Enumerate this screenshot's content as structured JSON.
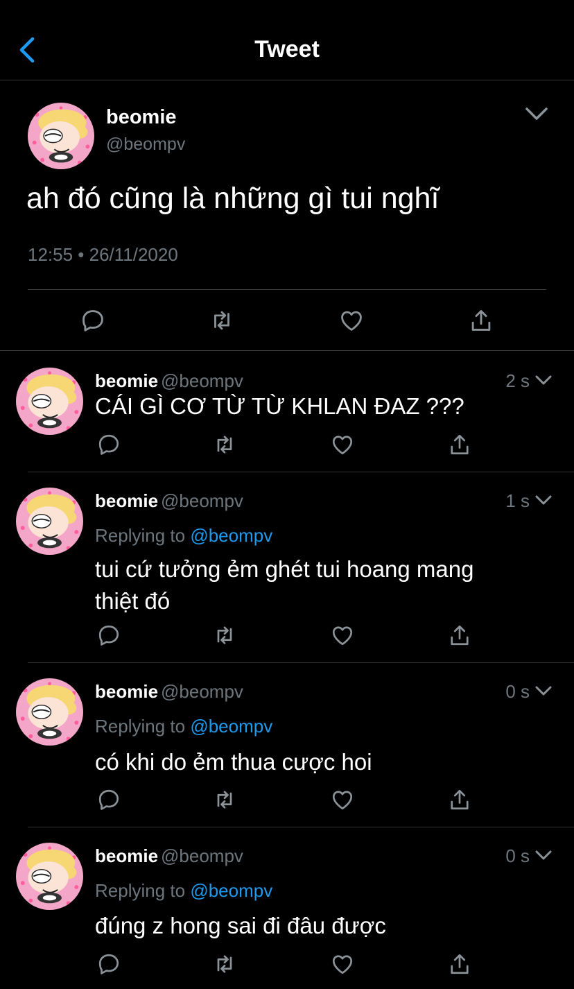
{
  "header": {
    "title": "Tweet",
    "back_icon": "chevron-left-icon"
  },
  "main_tweet": {
    "name": "beomie",
    "handle": "@beompv",
    "text": "ah đó cũng là những gì tui nghĩ",
    "timestamp": "12:55 • 26/11/2020"
  },
  "replies": [
    {
      "name": "beomie",
      "handle": "@beompv",
      "time": "2 s",
      "replying_label": "",
      "replying_to": "",
      "text": "CÁI GÌ CƠ TỪ TỪ KHLAN ĐAZ ???"
    },
    {
      "name": "beomie",
      "handle": "@beompv",
      "time": "1 s",
      "replying_label": "Replying to",
      "replying_to": "@beompv",
      "text": "tui cứ tưởng ẻm ghét tui hoang mang thiệt đó"
    },
    {
      "name": "beomie",
      "handle": "@beompv",
      "time": "0 s",
      "replying_label": "Replying to",
      "replying_to": "@beompv",
      "text": "có khi do ẻm thua cược hoi"
    },
    {
      "name": "beomie",
      "handle": "@beompv",
      "time": "0 s",
      "replying_label": "Replying to",
      "replying_to": "@beompv",
      "text": "đúng z hong sai đi đâu được"
    }
  ],
  "colors": {
    "background": "#000000",
    "text": "#ffffff",
    "muted": "#6e767d",
    "accent": "#1d9bf0",
    "avatar_bg": "#f4a6c8"
  }
}
